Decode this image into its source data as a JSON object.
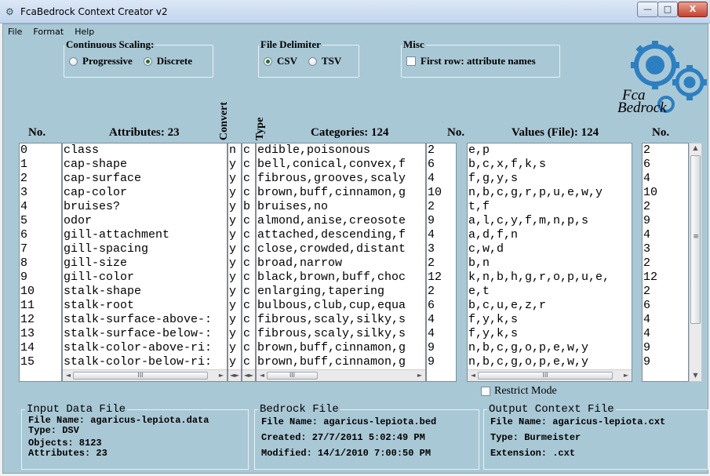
{
  "window": {
    "title": "FcaBedrock Context Creator v2",
    "min_glyph": "—",
    "max_glyph": "□",
    "close_glyph": "X"
  },
  "menu": [
    "File",
    "Format",
    "Help"
  ],
  "continuous_scaling": {
    "legend": "Continuous Scaling:",
    "options": [
      "Progressive",
      "Discrete"
    ],
    "selected": "Discrete"
  },
  "file_delimiter": {
    "legend": "File Delimiter",
    "options": [
      "CSV",
      "TSV"
    ],
    "selected": "CSV"
  },
  "misc": {
    "legend": "Misc",
    "first_row_label": "First row: attribute names",
    "first_row_checked": false
  },
  "logo": {
    "line1": "Fca",
    "line2": "Bedrock"
  },
  "headers": {
    "no": "No.",
    "attributes": "Attributes: 23",
    "convert": "Convert",
    "type": "Type",
    "categories": "Categories: 124",
    "no2": "No.",
    "values": "Values (File): 124",
    "no3": "No."
  },
  "rows": [
    {
      "no": "0",
      "attr": "class",
      "conv": "n",
      "type": "c",
      "cats": "edible,poisonous",
      "ncat": "2",
      "vals": "e,p",
      "nval": "2"
    },
    {
      "no": "1",
      "attr": "cap-shape",
      "conv": "y",
      "type": "c",
      "cats": "bell,conical,convex,f",
      "ncat": "6",
      "vals": "b,c,x,f,k,s",
      "nval": "6"
    },
    {
      "no": "2",
      "attr": "cap-surface",
      "conv": "y",
      "type": "c",
      "cats": "fibrous,grooves,scaly",
      "ncat": "4",
      "vals": "f,g,y,s",
      "nval": "4"
    },
    {
      "no": "3",
      "attr": "cap-color",
      "conv": "y",
      "type": "c",
      "cats": "brown,buff,cinnamon,g",
      "ncat": "10",
      "vals": "n,b,c,g,r,p,u,e,w,y",
      "nval": "10"
    },
    {
      "no": "4",
      "attr": "bruises?",
      "conv": "y",
      "type": "b",
      "cats": "bruises,no",
      "ncat": "2",
      "vals": "t,f",
      "nval": "2"
    },
    {
      "no": "5",
      "attr": "odor",
      "conv": "y",
      "type": "c",
      "cats": "almond,anise,creosote",
      "ncat": "9",
      "vals": "a,l,c,y,f,m,n,p,s",
      "nval": "9"
    },
    {
      "no": "6",
      "attr": "gill-attachment",
      "conv": "y",
      "type": "c",
      "cats": "attached,descending,f",
      "ncat": "4",
      "vals": "a,d,f,n",
      "nval": "4"
    },
    {
      "no": "7",
      "attr": "gill-spacing",
      "conv": "y",
      "type": "c",
      "cats": "close,crowded,distant",
      "ncat": "3",
      "vals": "c,w,d",
      "nval": "3"
    },
    {
      "no": "8",
      "attr": "gill-size",
      "conv": "y",
      "type": "c",
      "cats": "broad,narrow",
      "ncat": "2",
      "vals": "b,n",
      "nval": "2"
    },
    {
      "no": "9",
      "attr": "gill-color",
      "conv": "y",
      "type": "c",
      "cats": "black,brown,buff,choc",
      "ncat": "12",
      "vals": "k,n,b,h,g,r,o,p,u,e,",
      "nval": "12"
    },
    {
      "no": "10",
      "attr": "stalk-shape",
      "conv": "y",
      "type": "c",
      "cats": "enlarging,tapering",
      "ncat": "2",
      "vals": "e,t",
      "nval": "2"
    },
    {
      "no": "11",
      "attr": "stalk-root",
      "conv": "y",
      "type": "c",
      "cats": "bulbous,club,cup,equa",
      "ncat": "6",
      "vals": "b,c,u,e,z,r",
      "nval": "6"
    },
    {
      "no": "12",
      "attr": "stalk-surface-above-:",
      "conv": "y",
      "type": "c",
      "cats": "fibrous,scaly,silky,s",
      "ncat": "4",
      "vals": "f,y,k,s",
      "nval": "4"
    },
    {
      "no": "13",
      "attr": "stalk-surface-below-:",
      "conv": "y",
      "type": "c",
      "cats": "fibrous,scaly,silky,s",
      "ncat": "4",
      "vals": "f,y,k,s",
      "nval": "4"
    },
    {
      "no": "14",
      "attr": "stalk-color-above-ri:",
      "conv": "y",
      "type": "c",
      "cats": "brown,buff,cinnamon,g",
      "ncat": "9",
      "vals": "n,b,c,g,o,p,e,w,y",
      "nval": "9"
    },
    {
      "no": "15",
      "attr": "stalk-color-below-ri:",
      "conv": "y",
      "type": "c",
      "cats": "brown,buff,cinnamon,g",
      "ncat": "9",
      "vals": "n,b,c,g,o,p,e,w,y",
      "nval": "9"
    }
  ],
  "scroll": {
    "left": "◄",
    "right": "►",
    "up": "▲",
    "down": "▼",
    "grip": "≡",
    "thumb_grip": "III"
  },
  "restrict_mode": {
    "label": "Restrict Mode",
    "checked": false
  },
  "input_file": {
    "legend": "Input Data File",
    "lines": [
      "File Name: agaricus-lepiota.data",
      "Type: DSV",
      "Objects: 8123",
      "Attributes: 23"
    ]
  },
  "bedrock_file": {
    "legend": "Bedrock File",
    "lines": [
      "File Name: agaricus-lepiota.bed",
      "Created: 27/7/2011 5:02:49 PM",
      "Modified: 14/1/2010 7:00:50 PM"
    ]
  },
  "output_file": {
    "legend": "Output Context File",
    "lines": [
      "File Name: agaricus-lepiota.cxt",
      "Type: Burmeister",
      "Extension: .cxt"
    ]
  },
  "colors": {
    "client_bg": "#a9c8d5",
    "logo_blue": "#2c7fc1"
  }
}
